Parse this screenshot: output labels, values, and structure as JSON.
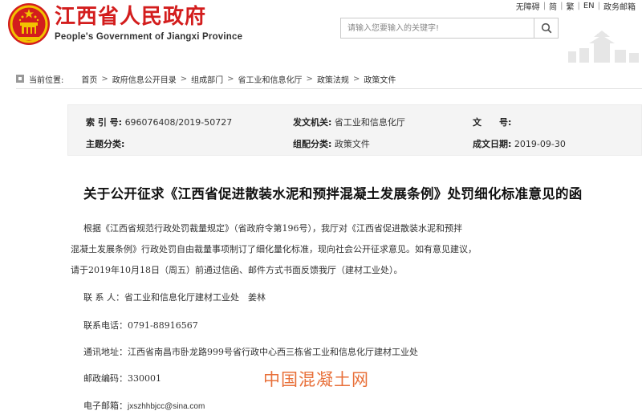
{
  "header": {
    "title": "江西省人民政府",
    "subtitle": "People's Government of Jiangxi Province",
    "top_links": [
      "无障碍",
      "简",
      "繁",
      "EN",
      "政务邮箱"
    ],
    "search_placeholder": "请输入您要输入的关键字!"
  },
  "breadcrumb": {
    "label": "当前位置:",
    "items": [
      "首页",
      "政府信息公开目录",
      "组成部门",
      "省工业和信息化厅",
      "政策法规",
      "政策文件"
    ]
  },
  "meta": {
    "index_label": "索 引 号:",
    "index_value": "696076408/2019-50727",
    "issuer_label": "发文机关:",
    "issuer_value": "省工业和信息化厅",
    "docno_label": "文　　号:",
    "docno_value": "",
    "topic_label": "主题分类:",
    "topic_value": "",
    "category_label": "组配分类:",
    "category_value": "政策文件",
    "date_label": "成文日期:",
    "date_value": "2019-09-30"
  },
  "article": {
    "title": "关于公开征求《江西省促进散装水泥和预拌混凝土发展条例》处罚细化标准意见的函",
    "paragraphs": [
      "根据《江西省规范行政处罚裁量规定》（省政府令第196号），我厅对《江西省促进散装水泥和预拌",
      "混凝土发展条例》行政处罚自由裁量事项制订了细化量化标准，现向社会公开征求意见。如有意见建议，",
      "请于2019年10月18日（周五）前通过信函、邮件方式书面反馈我厅（建材工业处）。"
    ],
    "contact_label": "联 系 人：",
    "contact_value": "省工业和信息化厅建材工业处　姜林",
    "phone_label": "联系电话：",
    "phone_value": "0791-88916567",
    "address_label": "通讯地址：",
    "address_value": "江西省南昌市卧龙路999号省行政中心西三栋省工业和信息化厅建材工业处",
    "postcode_label": "邮政编码：",
    "postcode_value": "330001",
    "email_label": "电子邮箱：",
    "email_value": "jxszhhbjcc@sina.com"
  },
  "watermark": "中国混凝土网",
  "colors": {
    "brand_red": "#d31d1d",
    "meta_bg": "#f4f4f4",
    "watermark": "#e8703a"
  }
}
